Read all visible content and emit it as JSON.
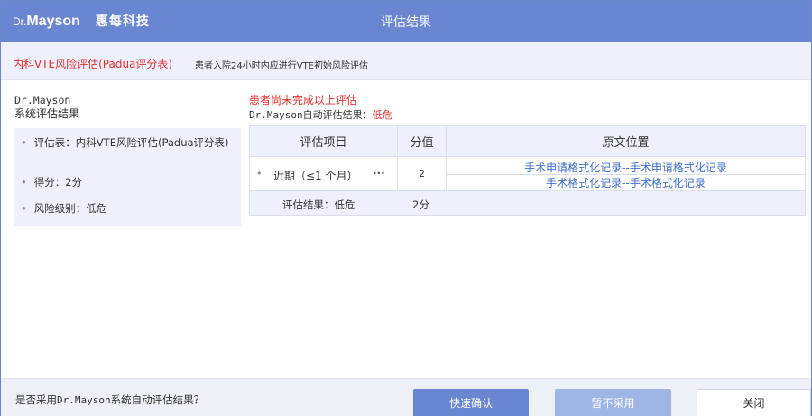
{
  "header": {
    "brand_prefix": "Dr.",
    "brand_name": "Mayson",
    "brand_company": "惠每科技",
    "title": "评估结果"
  },
  "info_bar": {
    "form_name": "内科VTE风险评估(Padua评分表)",
    "hint": "患者入院24小时内应进行VTE初始风险评估"
  },
  "left": {
    "heading_line1": "Dr.Mayson",
    "heading_line2": "系统评估结果",
    "items": [
      {
        "label": "评估表：",
        "value": "内科VTE风险评估(Padua评分表)"
      },
      {
        "label": "得分：",
        "value": "2分"
      },
      {
        "label": "风险级别：",
        "value": "低危"
      }
    ]
  },
  "status": {
    "warning": "患者尚未完成以上评估",
    "auto_result_label": "Dr.Mayson自动评估结果：",
    "auto_result_value": "低危"
  },
  "table": {
    "headers": [
      "评估项目",
      "分值",
      "原文位置"
    ],
    "rows": [
      {
        "item": "近期（≤1 个月）",
        "more": "···",
        "score": "2",
        "sources": [
          "手术申请格式化记录--手术申请格式化记录",
          "手术格式化记录--手术格式化记录"
        ]
      }
    ],
    "result_label": "评估结果：低危",
    "result_score": "2分"
  },
  "footer": {
    "question_prefix": "是否采用",
    "question_mono": "Dr.Mayson",
    "question_suffix": "系统自动评估结果？",
    "confirm_label": "快速确认",
    "reject_label": "暂不采用",
    "close_label": "关闭"
  },
  "colors": {
    "accent": "#6b86d0",
    "panel_bg": "#eef1fb",
    "warning_red": "#e52e2e",
    "link_blue": "#3f6fc9"
  }
}
